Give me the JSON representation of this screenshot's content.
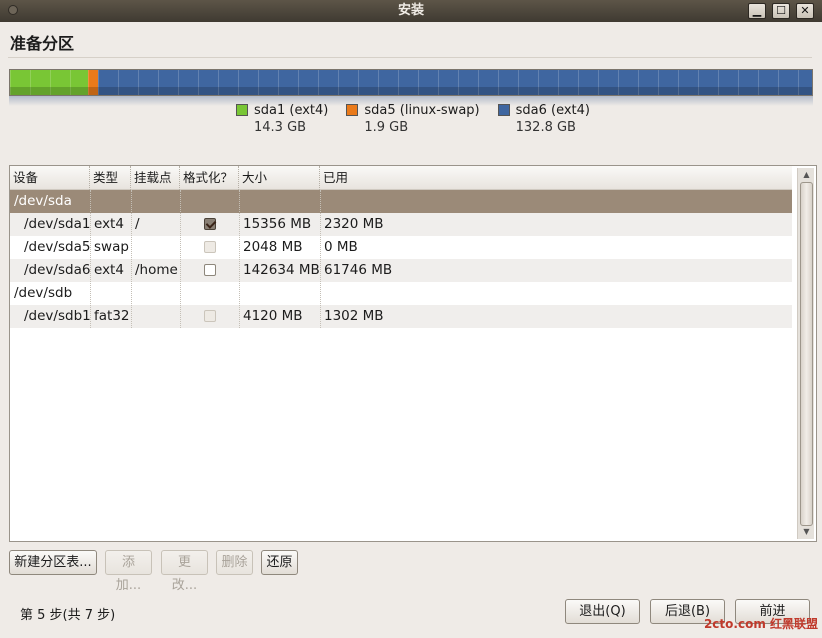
{
  "window": {
    "title": "安装"
  },
  "page": {
    "heading": "准备分区"
  },
  "disk_bar": {
    "segments": [
      {
        "name": "sda1 (ext4)",
        "size": "14.3 GB",
        "color": "#79c635",
        "fraction": 0.097
      },
      {
        "name": "sda5 (linux-swap)",
        "size": "1.9 GB",
        "color": "#ea7a1a",
        "fraction": 0.013
      },
      {
        "name": "sda6 (ext4)",
        "size": "132.8 GB",
        "color": "#3f66a0",
        "fraction": 0.89
      }
    ]
  },
  "table": {
    "headers": [
      "设备",
      "类型",
      "挂载点",
      "格式化？",
      "大小",
      "已用"
    ],
    "rows": [
      {
        "device": "/dev/sda",
        "type": "",
        "mount": "",
        "format": null,
        "size": "",
        "used": "",
        "selected": true
      },
      {
        "device": "/dev/sda1",
        "type": "ext4",
        "mount": "/",
        "format": "checked",
        "size": "15356 MB",
        "used": "2320 MB"
      },
      {
        "device": "/dev/sda5",
        "type": "swap",
        "mount": "",
        "format": "disabled",
        "size": "2048 MB",
        "used": "0 MB"
      },
      {
        "device": "/dev/sda6",
        "type": "ext4",
        "mount": "/home",
        "format": "unchecked",
        "size": "142634 MB",
        "used": "61746 MB"
      },
      {
        "device": "/dev/sdb",
        "type": "",
        "mount": "",
        "format": null,
        "size": "",
        "used": ""
      },
      {
        "device": "/dev/sdb1",
        "type": "fat32",
        "mount": "",
        "format": "disabled",
        "size": "4120 MB",
        "used": "1302 MB"
      }
    ]
  },
  "actions": {
    "new_table": "新建分区表...",
    "add": "添加...",
    "change": "更改...",
    "delete": "删除",
    "revert": "还原"
  },
  "footer": {
    "step": "第 5 步(共 7 步)",
    "quit": "退出(Q)",
    "back": "后退(B)",
    "forward": "前进"
  },
  "watermark": "2cto.com 红黑联盟"
}
